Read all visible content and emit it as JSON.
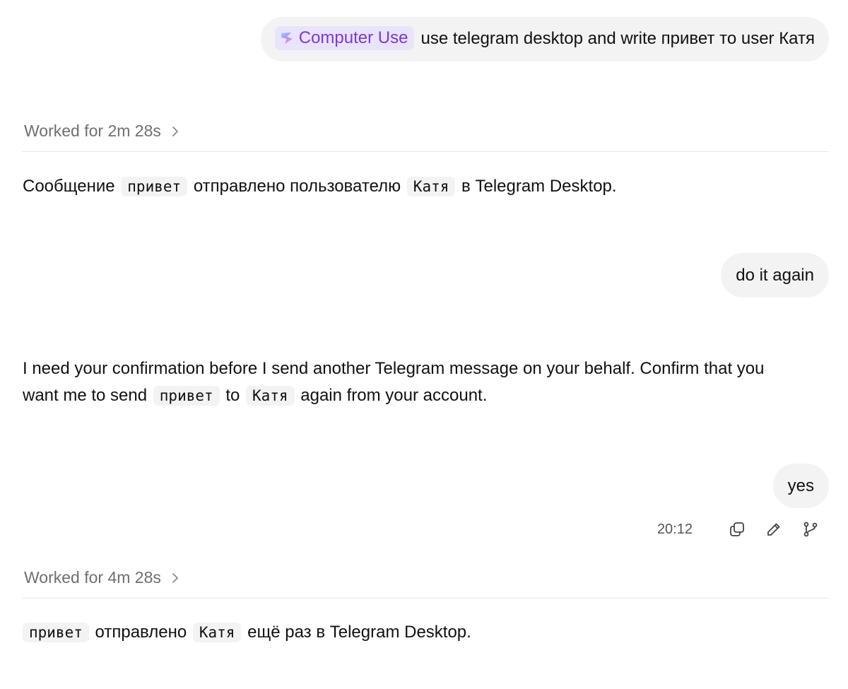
{
  "messages": {
    "user_1": {
      "tool_chip": "Computer Use",
      "text": "use telegram desktop and write привет то user Катя"
    },
    "worked_1": "Worked for 2m 28s",
    "assistant_1": {
      "p1": "Сообщение",
      "code1": "привет",
      "p2": "отправлено пользователю",
      "code2": "Катя",
      "p3": "в Telegram Desktop."
    },
    "user_2": "do it again",
    "assistant_2": {
      "line1": "I need your confirmation before I send another Telegram message on your behalf. Confirm that you",
      "p1": "want me to send",
      "code1": "привет",
      "p2": "to",
      "code2": "Катя",
      "p3": "again from your account."
    },
    "user_3": "yes",
    "actions": {
      "time": "20:12"
    },
    "worked_2": "Worked for 4m 28s",
    "assistant_3": {
      "code1": "привет",
      "p1": "отправлено",
      "code2": "Катя",
      "p2": "ещё раз в Telegram Desktop."
    }
  },
  "icons": {
    "chip": "computer-use-logo-icon",
    "chevron": "chevron-right-icon",
    "copy": "copy-icon",
    "edit": "pencil-icon",
    "branch": "branch-icon"
  },
  "colors": {
    "chip_bg": "#e9e3fb",
    "chip_text": "#7c3ad8",
    "bubble_bg": "#f3f3f3",
    "muted_text": "#6f6f6f"
  }
}
